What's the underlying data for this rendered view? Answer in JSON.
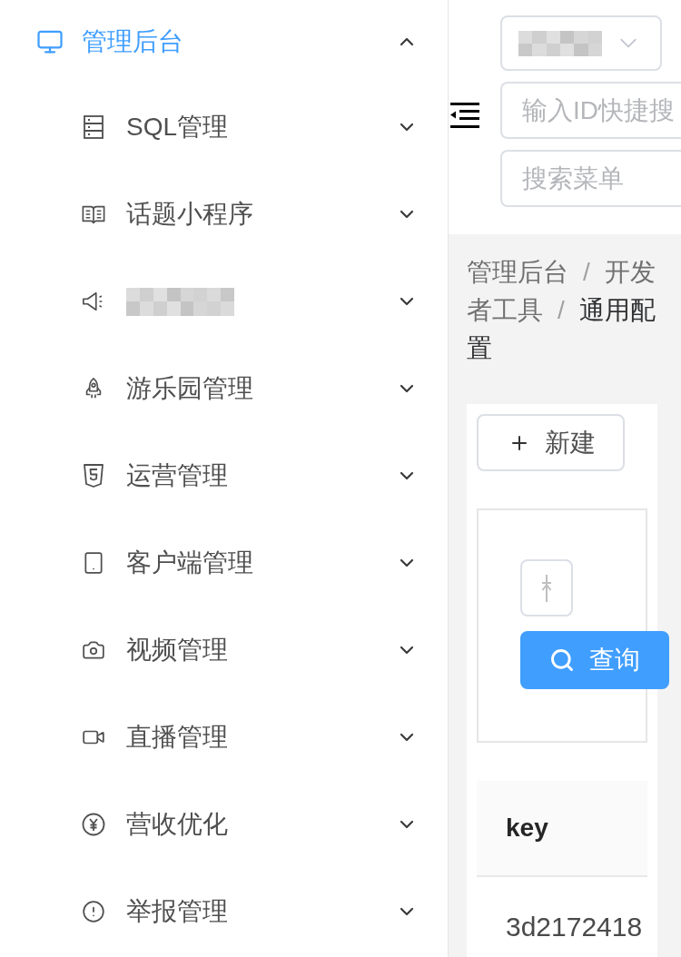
{
  "sidebar": {
    "items": [
      {
        "label": "管理后台",
        "selected": true,
        "expanded": true,
        "children": [
          {
            "label": "SQL管理",
            "selected": false,
            "expanded": false
          },
          {
            "label": "话题小程序",
            "selected": false,
            "expanded": false
          },
          {
            "selected": false,
            "expanded": false
          },
          {
            "label": "游乐园管理",
            "selected": false,
            "expanded": false
          },
          {
            "label": "运营管理",
            "selected": false,
            "expanded": false
          },
          {
            "label": "客户端管理",
            "selected": false,
            "expanded": false
          },
          {
            "label": "视频管理",
            "selected": false,
            "expanded": false
          },
          {
            "label": "直播管理",
            "selected": false,
            "expanded": false
          },
          {
            "label": "营收优化",
            "selected": false,
            "expanded": false
          },
          {
            "label": "举报管理",
            "selected": false,
            "expanded": false
          }
        ]
      }
    ]
  },
  "header": {
    "fields": [
      {
        "kind": "select"
      },
      {
        "kind": "input",
        "placeholder": "输入ID快捷搜"
      },
      {
        "kind": "input",
        "placeholder": "搜索菜单"
      }
    ]
  },
  "breadcrumb": [
    {
      "label": "管理后台",
      "current": false,
      "separator": "/"
    },
    {
      "label": "开发者工具",
      "current": false,
      "separator": "/"
    },
    {
      "label": "通用配置",
      "current": true
    }
  ],
  "toolbar": {
    "new_button": "新建"
  },
  "filter": {
    "query_button": "查询"
  },
  "table": {
    "columns": [
      "key"
    ],
    "rows": [
      [
        "3d2172418"
      ]
    ]
  }
}
